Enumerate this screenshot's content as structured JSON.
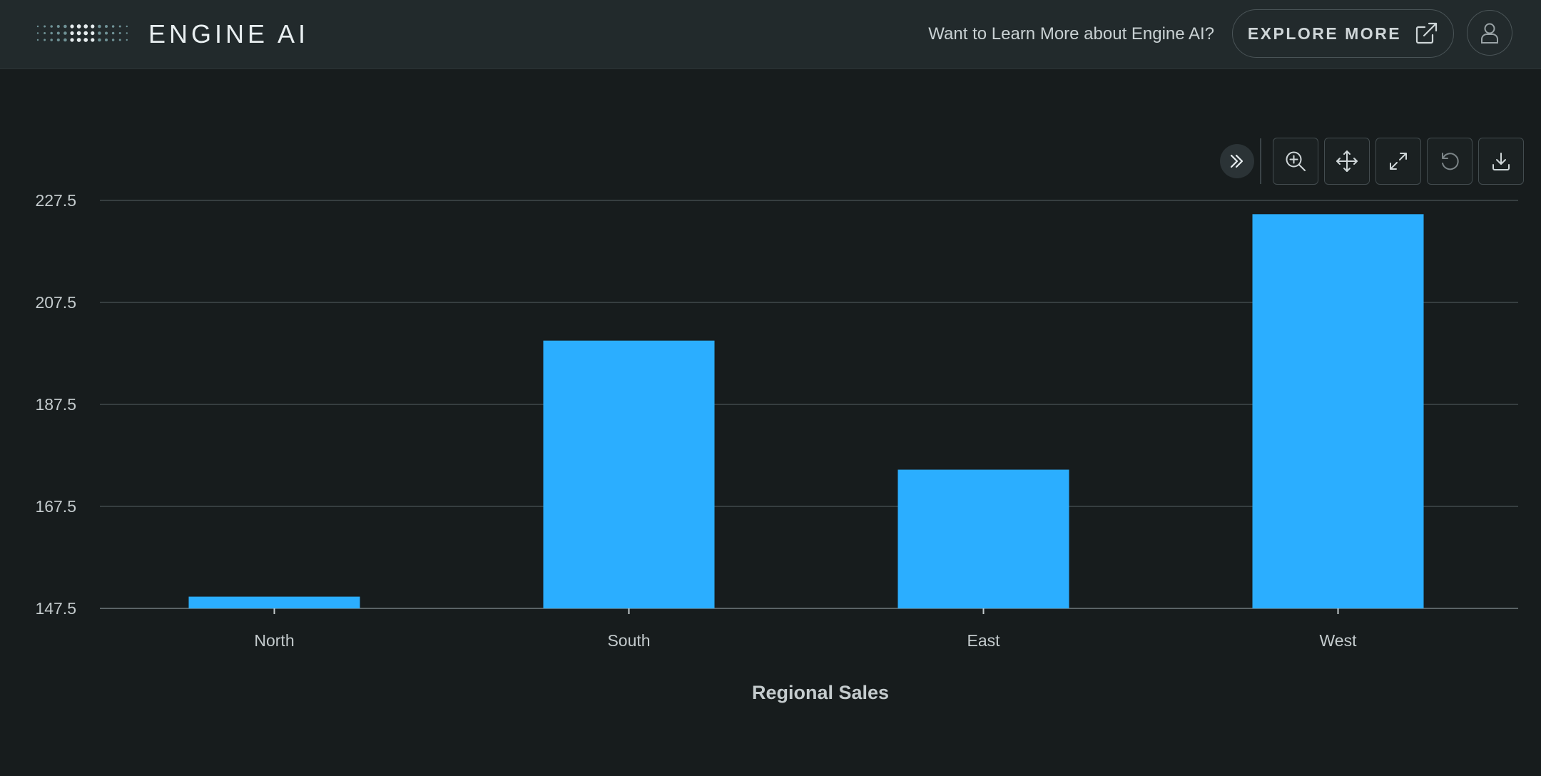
{
  "header": {
    "brand": "ENGINE AI",
    "promo_text": "Want to Learn More about Engine AI?",
    "explore_label": "EXPLORE MORE"
  },
  "toolbar": {
    "icons": [
      "expand-panel-icon",
      "zoom-in-icon",
      "pan-icon",
      "fullscreen-icon",
      "reset-icon",
      "download-icon"
    ]
  },
  "colors": {
    "background": "#171c1d",
    "header": "#222a2c",
    "bar": "#2baeff",
    "grid": "#41494c"
  },
  "chart_data": {
    "type": "bar",
    "categories": [
      "North",
      "South",
      "East",
      "West"
    ],
    "values": [
      149.8,
      200.0,
      174.7,
      224.8
    ],
    "xlabel": "Regional Sales",
    "ylabel": "",
    "ylim": [
      147.5,
      227.5
    ],
    "yticks": [
      "147.5",
      "167.5",
      "187.5",
      "207.5",
      "227.5"
    ],
    "grid": true
  }
}
